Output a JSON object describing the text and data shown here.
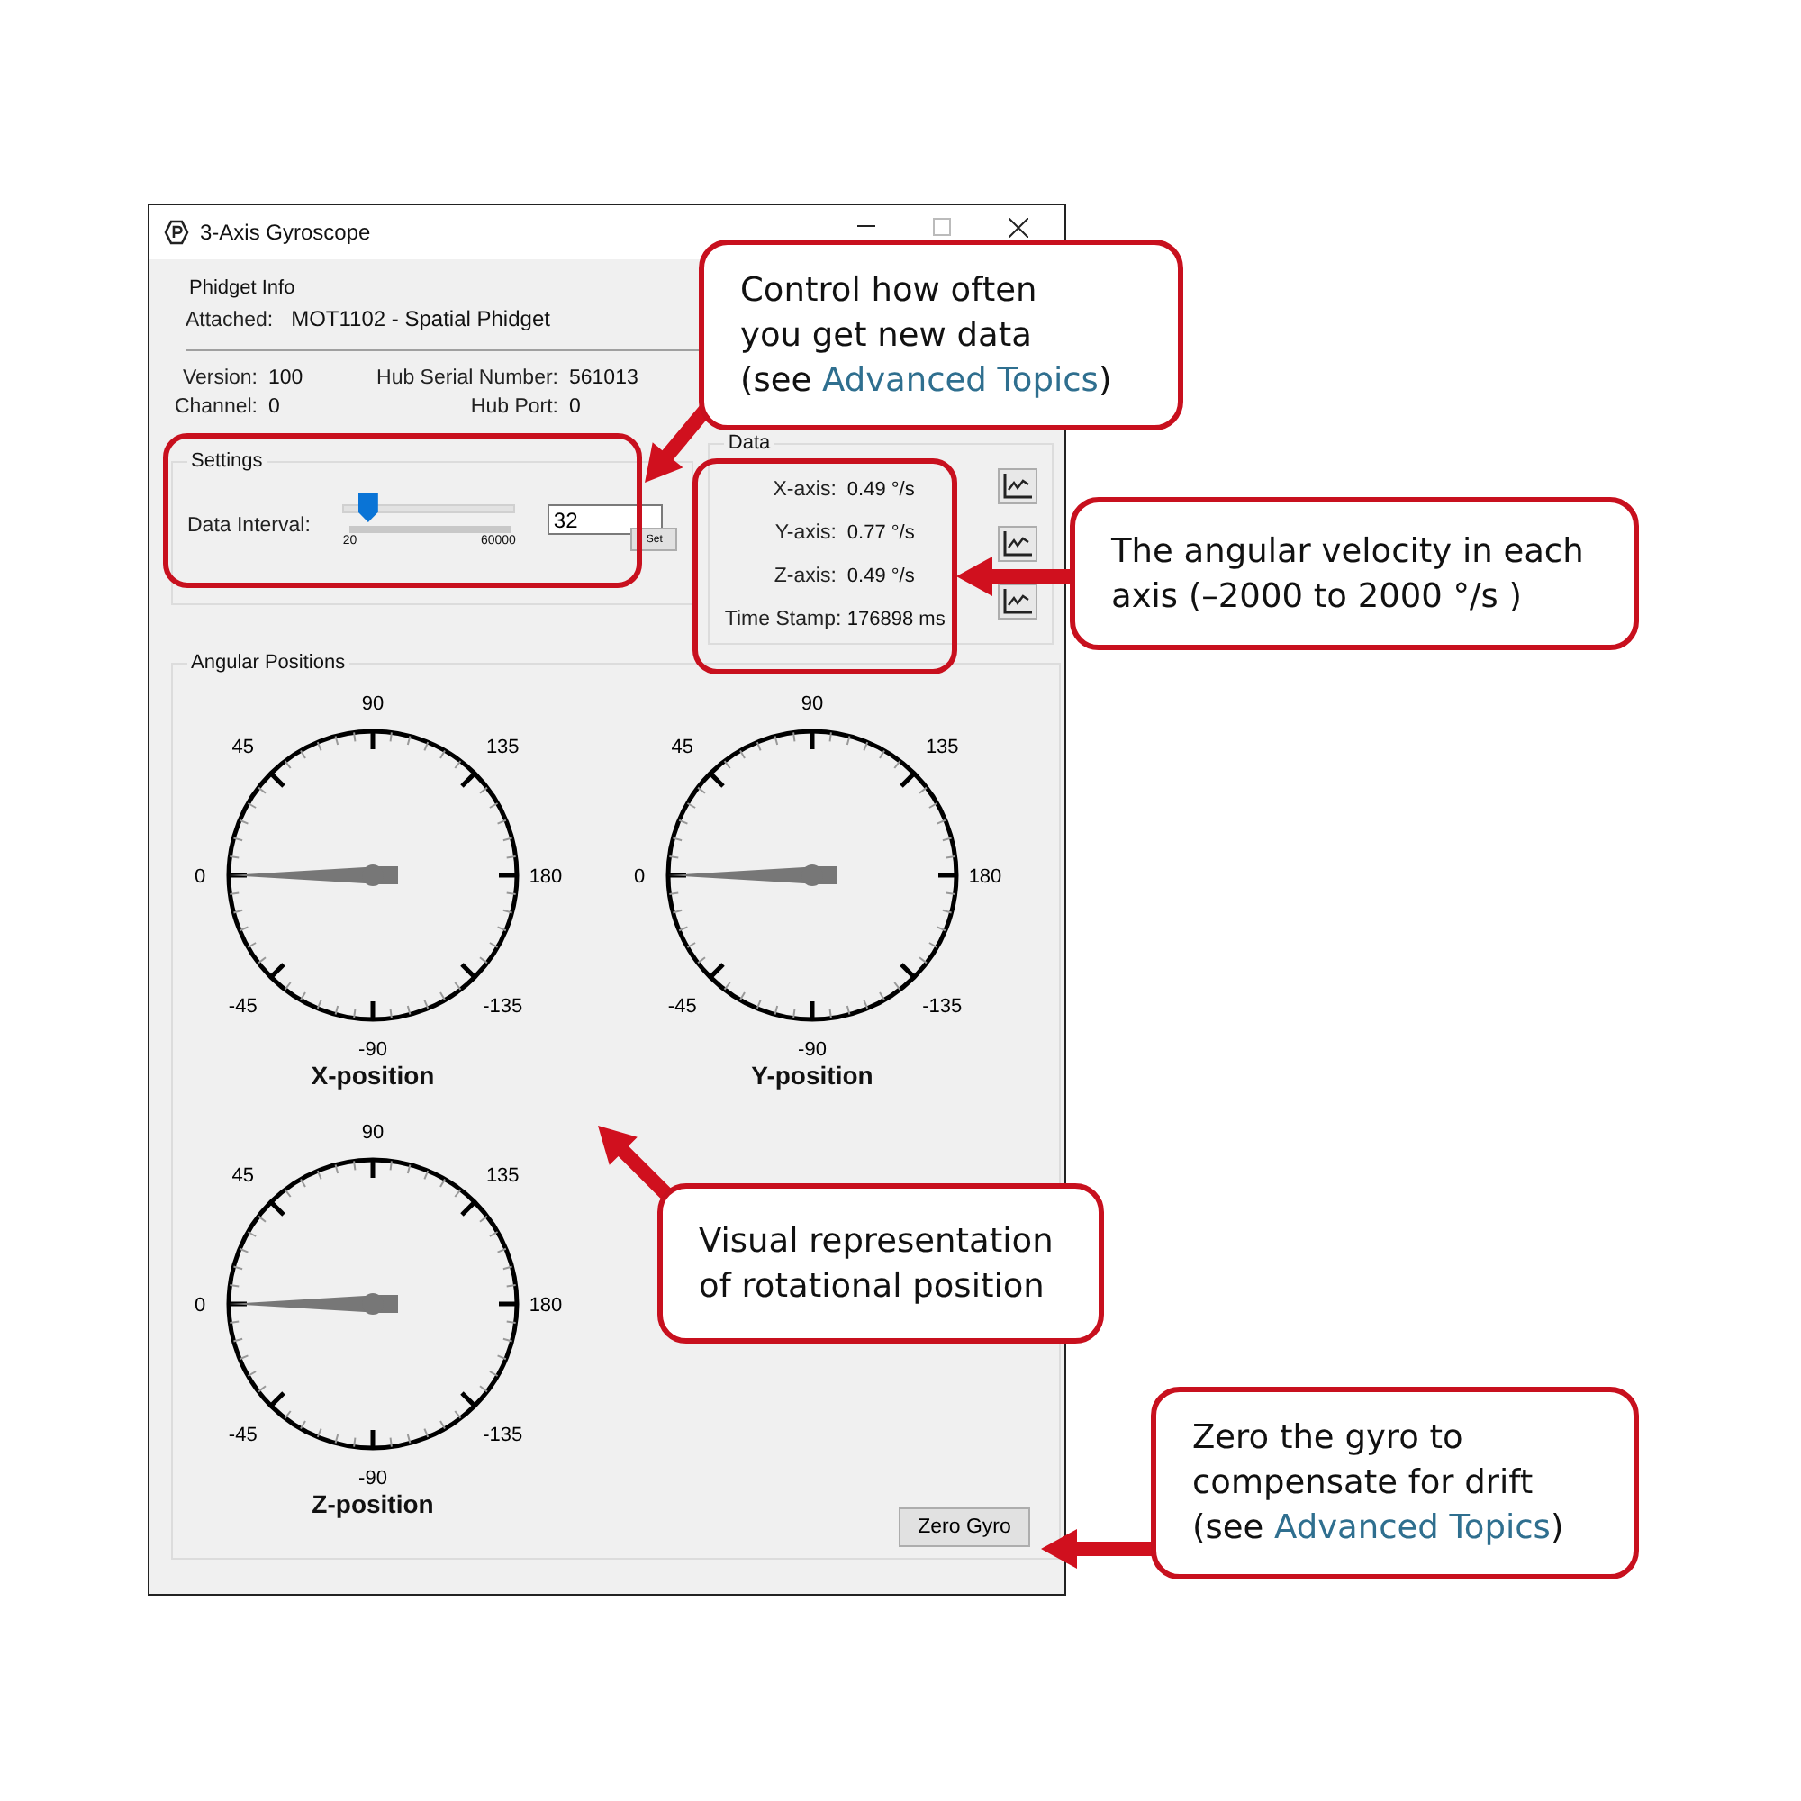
{
  "window": {
    "title": "3-Axis Gyroscope"
  },
  "phidget_info": {
    "title": "Phidget Info",
    "attached_label": "Attached:",
    "attached_value": "MOT1102 - Spatial Phidget",
    "version_label": "Version:",
    "version_value": "100",
    "hub_serial_label": "Hub Serial Number:",
    "hub_serial_value": "561013",
    "channel_label": "Channel:",
    "channel_value": "0",
    "hub_port_label": "Hub Port:",
    "hub_port_value": "0"
  },
  "settings": {
    "title": "Settings",
    "label": "Data Interval:",
    "slider": {
      "level": 0.1,
      "min_label": "20",
      "max_label": "60000"
    },
    "value": "32",
    "set_button": "Set"
  },
  "data": {
    "title": "Data",
    "rows": [
      {
        "label": "X-axis:",
        "value": "0.49 °/s"
      },
      {
        "label": "Y-axis:",
        "value": "0.77 °/s"
      },
      {
        "label": "Z-axis:",
        "value": "0.49 °/s"
      },
      {
        "label": "Time Stamp:",
        "value": "176898 ms"
      }
    ]
  },
  "angular_positions": {
    "title": "Angular Positions",
    "gauges": [
      {
        "label": "X-position",
        "scale": [
          "90",
          "135",
          "180",
          "-135",
          "-90",
          "-45",
          "0",
          "45"
        ]
      },
      {
        "label": "Y-position",
        "scale": [
          "90",
          "135",
          "180",
          "-135",
          "-90",
          "-45",
          "0",
          "45"
        ]
      },
      {
        "label": "Z-position",
        "scale": [
          "90",
          "135",
          "180",
          "-135",
          "-90",
          "-45",
          "0",
          "45"
        ]
      }
    ]
  },
  "zero_button": "Zero Gyro",
  "callouts": [
    {
      "lines": [
        "Control how often",
        "you get new data"
      ],
      "prefix": "(see ",
      "link": "Advanced Topics",
      "suffix": ")"
    },
    {
      "lines": [
        "The angular velocity in each",
        "axis (–2000 to 2000 °/s )"
      ]
    },
    {
      "lines": [
        "Visual representation",
        "of rotational position"
      ]
    },
    {
      "lines": [
        "Zero the gyro to",
        "compensate for drift"
      ],
      "prefix": "(see ",
      "link": "Advanced Topics",
      "suffix": ")"
    }
  ]
}
